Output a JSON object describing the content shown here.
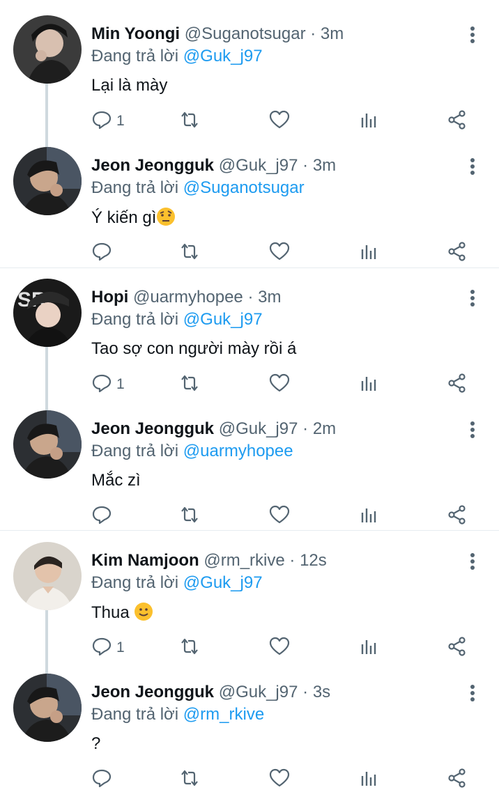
{
  "reply_prefix": "Đang trả lời",
  "tweets": [
    {
      "name": "Min Yoongi",
      "handle": "@Suganotsugar",
      "time": "3m",
      "reply_to": "@Guk_j97",
      "text": "Lại là mày",
      "reply_count": "1"
    },
    {
      "name": "Jeon Jeongguk",
      "handle": "@Guk_j97",
      "time": "3m",
      "reply_to": "@Suganotsugar",
      "text": "Ý kiến gì",
      "emoji": "raised-eyebrow-emoji",
      "reply_count": ""
    },
    {
      "name": "Hopi",
      "handle": "@uarmyhopee",
      "time": "3m",
      "reply_to": "@Guk_j97",
      "text": "Tao sợ con người mày rồi á",
      "reply_count": "1"
    },
    {
      "name": "Jeon Jeongguk",
      "handle": "@Guk_j97",
      "time": "2m",
      "reply_to": "@uarmyhopee",
      "text": "Mắc zì",
      "reply_count": ""
    },
    {
      "name": "Kim Namjoon",
      "handle": "@rm_rkive",
      "time": "12s",
      "reply_to": "@Guk_j97",
      "text": "Thua ",
      "emoji": "slight-smile-emoji",
      "reply_count": "1"
    },
    {
      "name": "Jeon Jeongguk",
      "handle": "@Guk_j97",
      "time": "3s",
      "reply_to": "@rm_rkive",
      "text": "?",
      "reply_count": ""
    }
  ],
  "separator": "·",
  "icons": {
    "reply": "reply-icon",
    "retweet": "retweet-icon",
    "like": "heart-icon",
    "analytics": "analytics-icon",
    "share": "share-icon",
    "more": "more-vertical-icon"
  },
  "colors": {
    "link": "#1d9bf0",
    "muted": "#536471",
    "text": "#0f1419"
  }
}
